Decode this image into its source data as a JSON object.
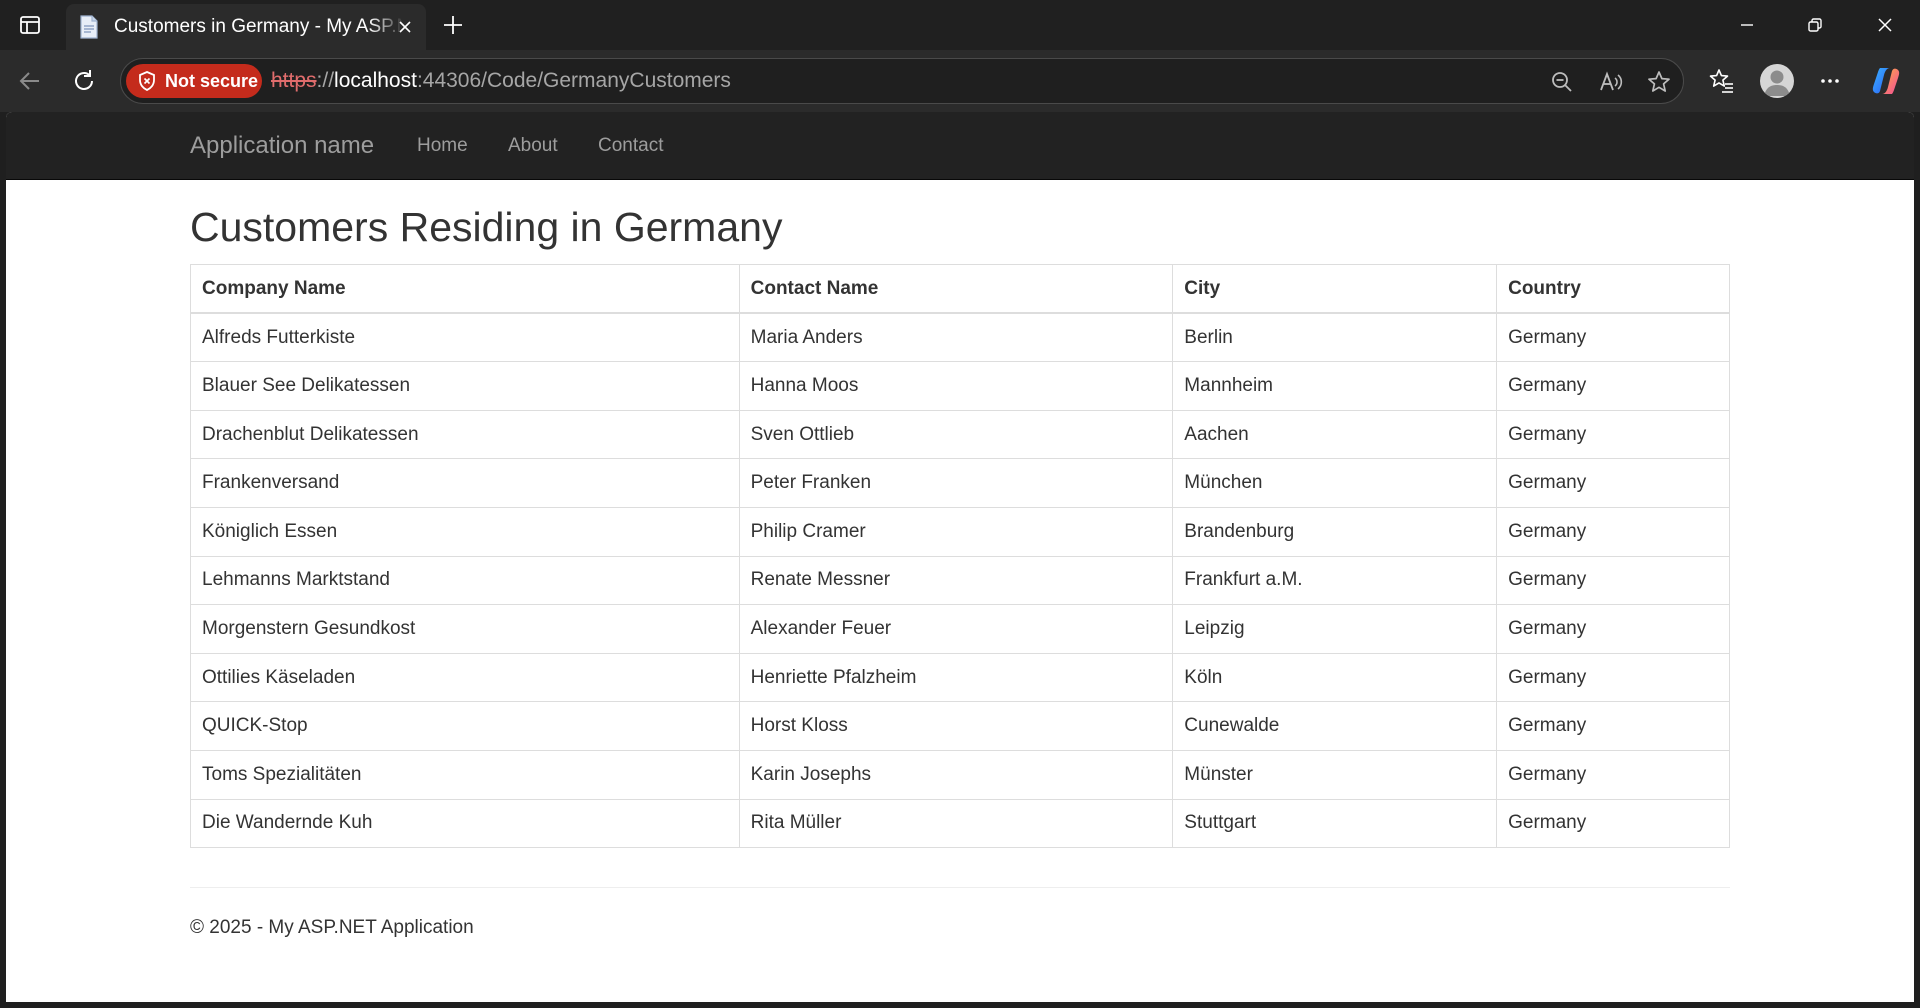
{
  "browser": {
    "tab_title": "Customers in Germany - My ASP.NET Application",
    "security_label": "Not secure",
    "url": {
      "scheme": "https",
      "separator": "://",
      "host": "localhost",
      "rest": ":44306/Code/GermanyCustomers"
    },
    "icons": [
      "sidebar-toggle-icon",
      "page-favicon-icon",
      "close-icon",
      "plus-icon",
      "back-arrow-icon",
      "refresh-icon",
      "shield-icon",
      "zoom-out-icon",
      "read-aloud-icon",
      "star-icon",
      "favorites-icon",
      "profile-icon",
      "more-icon",
      "copilot-icon",
      "minimize-icon",
      "restore-icon"
    ]
  },
  "app": {
    "brand": "Application name",
    "nav": [
      "Home",
      "About",
      "Contact"
    ]
  },
  "page": {
    "title": "Customers Residing in Germany",
    "table": {
      "headers": [
        "Company Name",
        "Contact Name",
        "City",
        "Country"
      ],
      "rows": [
        [
          "Alfreds Futterkiste",
          "Maria Anders",
          "Berlin",
          "Germany"
        ],
        [
          "Blauer See Delikatessen",
          "Hanna Moos",
          "Mannheim",
          "Germany"
        ],
        [
          "Drachenblut Delikatessen",
          "Sven Ottlieb",
          "Aachen",
          "Germany"
        ],
        [
          "Frankenversand",
          "Peter Franken",
          "München",
          "Germany"
        ],
        [
          "Königlich Essen",
          "Philip Cramer",
          "Brandenburg",
          "Germany"
        ],
        [
          "Lehmanns Marktstand",
          "Renate Messner",
          "Frankfurt a.M.",
          "Germany"
        ],
        [
          "Morgenstern Gesundkost",
          "Alexander Feuer",
          "Leipzig",
          "Germany"
        ],
        [
          "Ottilies Käseladen",
          "Henriette Pfalzheim",
          "Köln",
          "Germany"
        ],
        [
          "QUICK-Stop",
          "Horst Kloss",
          "Cunewalde",
          "Germany"
        ],
        [
          "Toms Spezialitäten",
          "Karin Josephs",
          "Münster",
          "Germany"
        ],
        [
          "Die Wandernde Kuh",
          "Rita Müller",
          "Stuttgart",
          "Germany"
        ]
      ]
    },
    "footer": "© 2025 - My ASP.NET Application"
  },
  "colors": {
    "navbar_bg": "#222222",
    "navbar_text": "#9d9d9d",
    "not_secure_red": "#c42b1c",
    "table_border": "#dddddd",
    "text": "#333333"
  }
}
